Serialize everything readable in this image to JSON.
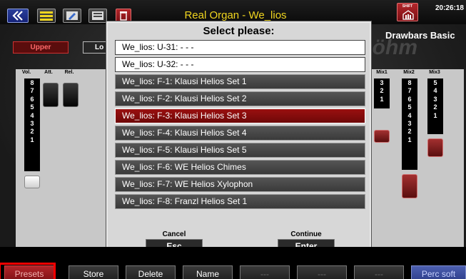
{
  "topbar": {
    "title": "Real Organ - We_lios",
    "clock": "20:26:18",
    "shift_label": "SHIFT",
    "icons": [
      "back-icon",
      "menu-icon",
      "edit-icon",
      "edit-list-icon",
      "delete-icon"
    ]
  },
  "panel": {
    "title": "Drawbars Basic",
    "tabs": {
      "upper": "Upper",
      "lower": "Lo"
    },
    "left_columns": [
      "Vol.",
      "Att.",
      "Rel."
    ],
    "right_columns": [
      "Mix1",
      "Mix2",
      "Mix3"
    ],
    "vol_numbers": [
      "8",
      "7",
      "6",
      "5",
      "4",
      "3",
      "2",
      "1"
    ],
    "mix1_numbers": [
      "3",
      "2",
      "1"
    ],
    "mix2_numbers": [
      "8",
      "7",
      "6",
      "5",
      "4",
      "3",
      "2",
      "1"
    ],
    "mix3_numbers": [
      "5",
      "4",
      "3",
      "2",
      "1"
    ]
  },
  "dialog": {
    "title": "Select please:",
    "selected_index": 3,
    "items": [
      {
        "label": "We_lios: U-31: - - -"
      },
      {
        "label": "We_lios: U-32: - - -"
      },
      {
        "label": "We_lios: F-1: Klausi Helios Set 1"
      },
      {
        "label": "We_lios: F-2: Klausi Helios Set 2"
      },
      {
        "label": "We_lios: F-3: Klausi Helios Set 3"
      },
      {
        "label": "We_lios: F-4: Klausi Helios Set 4"
      },
      {
        "label": "We_lios: F-5: Klausi Helios Set 5"
      },
      {
        "label": "We_lios: F-6: WE Helios Chimes"
      },
      {
        "label": "We_lios: F-7: WE Helios Xylophon"
      },
      {
        "label": "We_lios: F-8: Franzl Helios Set 1"
      }
    ],
    "cancel": {
      "label": "Cancel",
      "key": "Esc"
    },
    "continue": {
      "label": "Continue",
      "key": "Enter"
    }
  },
  "softkeys": [
    {
      "label": "Presets"
    },
    {
      "label": "Store"
    },
    {
      "label": "Delete"
    },
    {
      "label": "Name"
    },
    {
      "label": "---"
    },
    {
      "label": "---"
    },
    {
      "label": "---"
    },
    {
      "label": "Perc soft"
    }
  ],
  "colors": {
    "accent_red": "#b3262a",
    "title_yellow": "#f0d51f",
    "selected_row": "#8a0c0c"
  }
}
